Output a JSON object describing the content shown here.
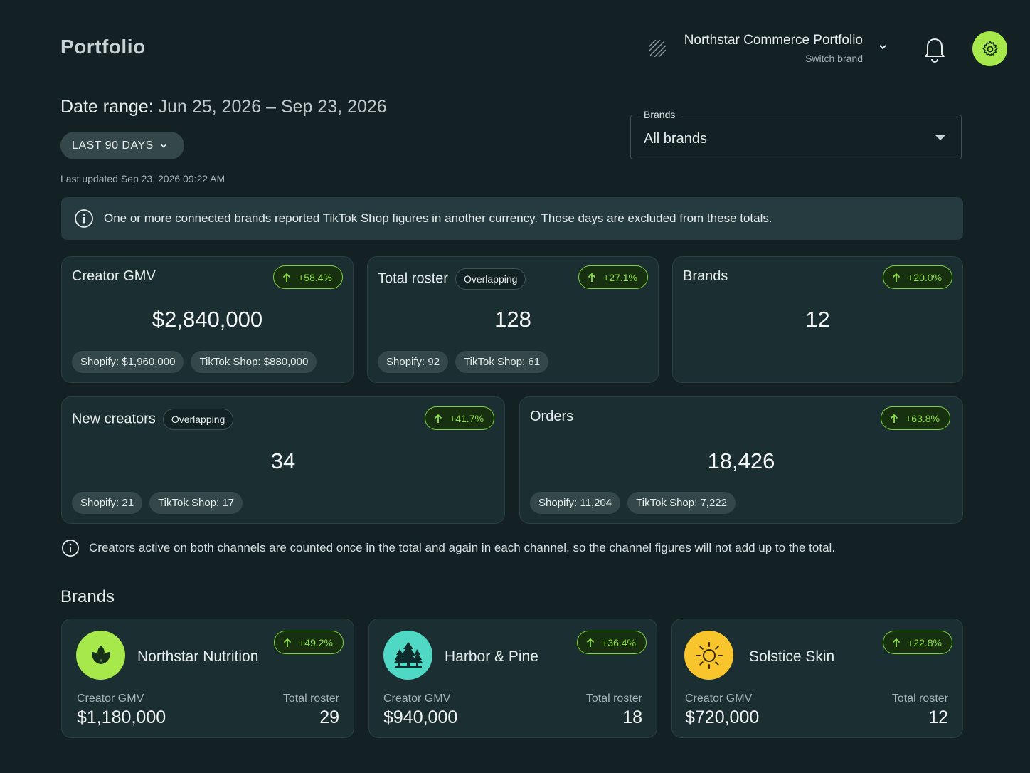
{
  "header": {
    "title": "Portfolio",
    "portfolio_name": "Northstar Commerce Portfolio",
    "switch_label": "Switch brand"
  },
  "date_range": {
    "label": "Date range:",
    "value": "Jun 25, 2026 – Sep 23, 2026",
    "preset_label": "LAST 90 DAYS",
    "last_updated": "Last updated Sep 23, 2026 09:22 AM"
  },
  "brand_filter": {
    "legend": "Brands",
    "value": "All brands"
  },
  "banner": {
    "text": "One or more connected brands reported TikTok Shop figures in another currency. Those days are excluded from these totals."
  },
  "stats": {
    "creator_gmv": {
      "title": "Creator GMV",
      "delta": "+58.4%",
      "value": "$2,840,000",
      "chips": [
        "Shopify: $1,960,000",
        "TikTok Shop:  $880,000"
      ]
    },
    "total_roster": {
      "title": "Total roster",
      "tag": "Overlapping",
      "delta": "+27.1%",
      "value": "128",
      "chips": [
        "Shopify: 92",
        "TikTok Shop:  61"
      ]
    },
    "brands": {
      "title": "Brands",
      "delta": "+20.0%",
      "value": "12"
    },
    "new_creators": {
      "title": "New creators",
      "tag": "Overlapping",
      "delta": "+41.7%",
      "value": "34",
      "chips": [
        "Shopify: 21",
        "TikTok Shop: 17"
      ]
    },
    "orders": {
      "title": "Orders",
      "delta": "+63.8%",
      "value": "18,426",
      "chips": [
        "Shopify: 11,204",
        "TikTok Shop: 7,222"
      ]
    }
  },
  "note": {
    "text": "Creators active on both channels are counted once in the total and again in each channel, so the channel figures will not add up to the total."
  },
  "brands_section": {
    "title": "Brands",
    "items": [
      {
        "name": "Northstar Nutrition",
        "delta": "+49.2%",
        "gmv_label": "Creator GMV",
        "gmv": "$1,180,000",
        "roster_label": "Total roster",
        "roster": "29",
        "logo_color": "#a7e84b",
        "icon": "leaf-icon"
      },
      {
        "name": "Harbor & Pine",
        "delta": "+36.4%",
        "gmv_label": "Creator GMV",
        "gmv": "$940,000",
        "roster_label": "Total roster",
        "roster": "18",
        "logo_color": "#4fd8c4",
        "icon": "pine-trees-icon"
      },
      {
        "name": "Solstice Skin",
        "delta": "+22.8%",
        "gmv_label": "Creator GMV",
        "gmv": "$720,000",
        "roster_label": "Total roster",
        "roster": "12",
        "logo_color": "#f8c52c",
        "icon": "sun-icon"
      }
    ]
  },
  "colors": {
    "background": "#132024",
    "accent": "#a7e84b",
    "delta_green": "#8fe04a",
    "card": "#1b2e31"
  }
}
